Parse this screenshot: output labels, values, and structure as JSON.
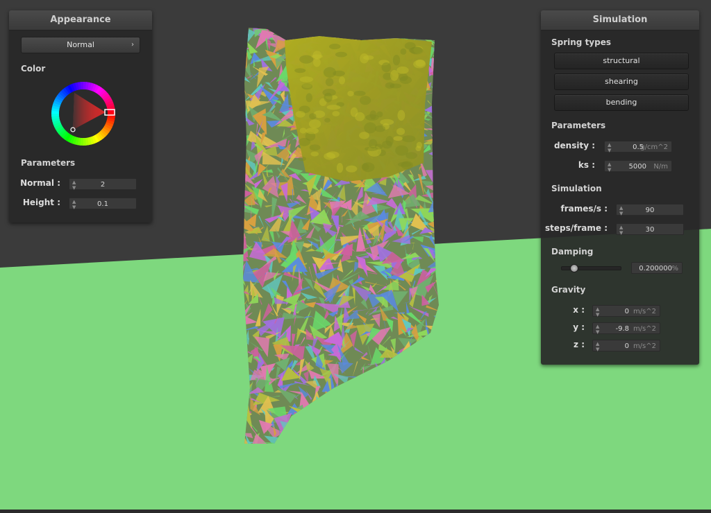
{
  "colors": {
    "background": "#3b3b3b",
    "floor": "#7ed87e",
    "cloth_top": "#a8a81e"
  },
  "appearance": {
    "title": "Appearance",
    "shader_value": "Normal",
    "color_label": "Color",
    "parameters_label": "Parameters",
    "normal": {
      "label": "Normal :",
      "value": "2"
    },
    "height": {
      "label": "Height :",
      "value": "0.1"
    }
  },
  "simulation": {
    "title": "Simulation",
    "spring_types_label": "Spring types",
    "springs": [
      "structural",
      "shearing",
      "bending"
    ],
    "parameters_label": "Parameters",
    "density": {
      "label": "density :",
      "value": "0.5",
      "unit": "g/cm^2"
    },
    "ks": {
      "label": "ks :",
      "value": "5000",
      "unit": "N/m"
    },
    "simulation_label": "Simulation",
    "frames": {
      "label": "frames/s :",
      "value": "90"
    },
    "steps": {
      "label": "steps/frame :",
      "value": "30"
    },
    "damping_label": "Damping",
    "damping": {
      "value": "0.200000",
      "unit": "%",
      "slider_fraction": 0.2
    },
    "gravity_label": "Gravity",
    "gravity": [
      {
        "label": "x :",
        "value": "0",
        "unit": "m/s^2"
      },
      {
        "label": "y :",
        "value": "-9.8",
        "unit": "m/s^2"
      },
      {
        "label": "z :",
        "value": "0",
        "unit": "m/s^2"
      }
    ]
  }
}
